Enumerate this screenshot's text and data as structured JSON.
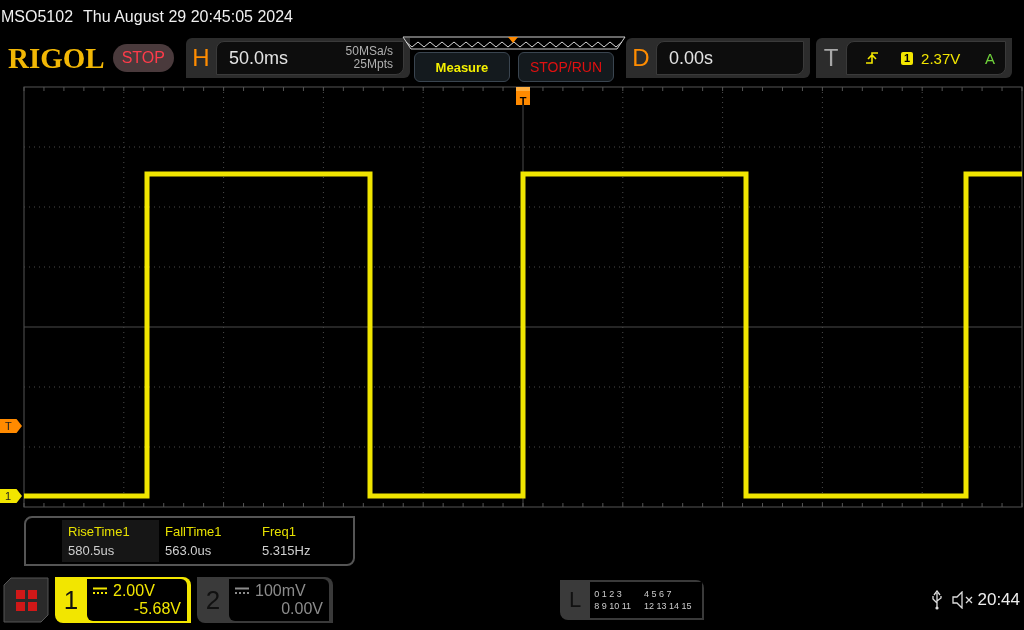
{
  "status_line": {
    "model": "MSO5102",
    "datetime": "Thu August 29 20:45:05 2024"
  },
  "header": {
    "logo": "RIGOL",
    "run_state": "STOP",
    "horizontal": {
      "label": "H",
      "timebase": "50.0ms",
      "sample_rate": "50MSa/s",
      "memory_depth": "25Mpts"
    },
    "buttons": [
      {
        "label": "Measure",
        "kind": "measure"
      },
      {
        "label": "STOP/RUN",
        "kind": "run"
      }
    ],
    "delay": {
      "label": "D",
      "value": "0.00s"
    },
    "trigger": {
      "label": "T",
      "source": "1",
      "level": "2.37V",
      "mode": "A"
    }
  },
  "plot": {
    "trigger_position_marker": "T",
    "trigger_level_marker": "T",
    "channel_marker": "1"
  },
  "measurements": [
    {
      "name": "RiseTime1",
      "value": "580.5us",
      "selected": true
    },
    {
      "name": "FallTime1",
      "value": "563.0us",
      "selected": false
    },
    {
      "name": "Freq1",
      "value": "5.315Hz",
      "selected": false
    }
  ],
  "channels": [
    {
      "number": "1",
      "scale": "2.00V",
      "offset": "-5.68V",
      "on": true
    },
    {
      "number": "2",
      "scale": "100mV",
      "offset": "0.00V",
      "on": false
    }
  ],
  "logic": {
    "label": "L",
    "groups": [
      "0 1 2 3",
      "4 5 6 7",
      "8 9 10 11",
      "12 13 14 15"
    ]
  },
  "status_bar": {
    "time": "20:44"
  }
}
